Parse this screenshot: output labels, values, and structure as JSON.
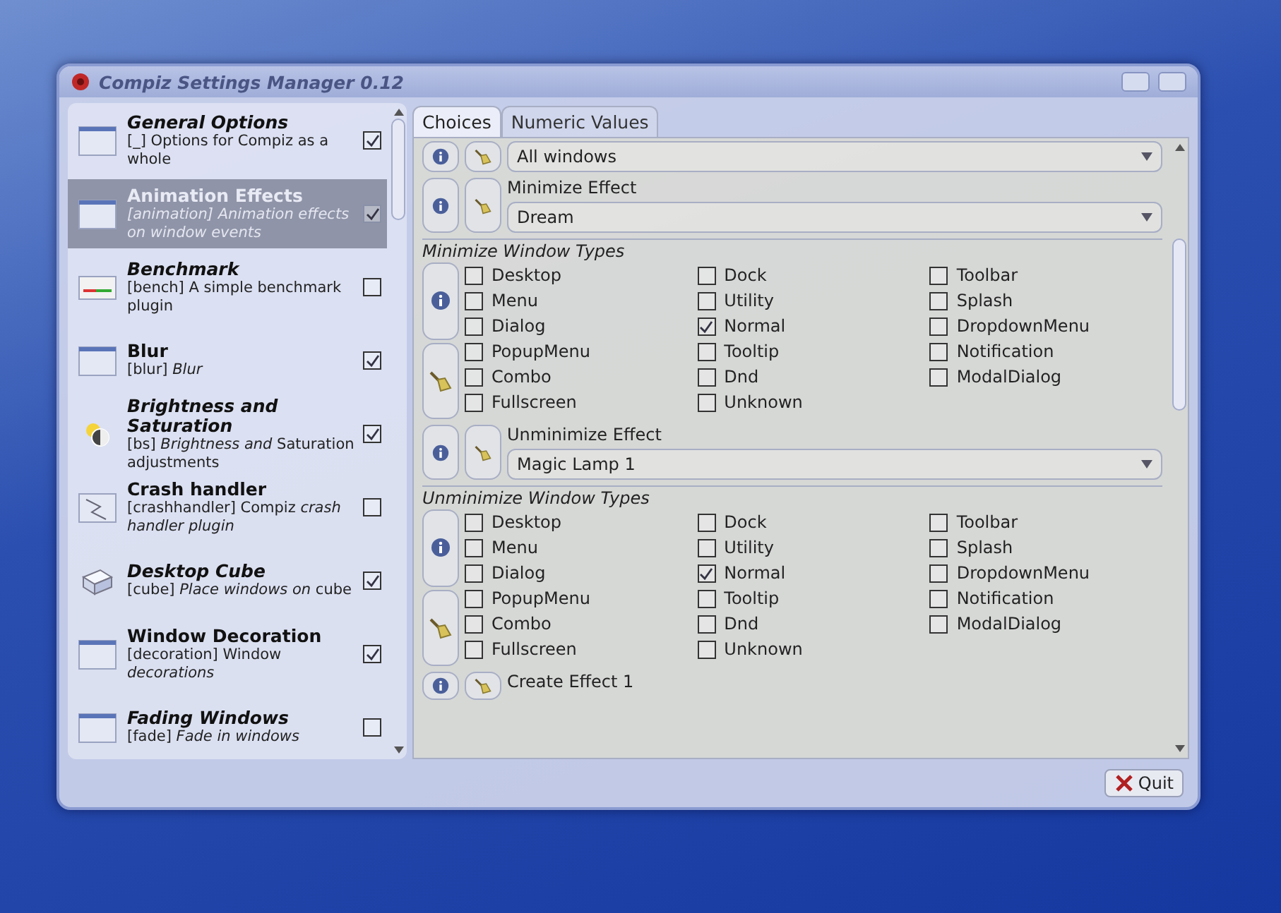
{
  "window": {
    "title": "Compiz Settings Manager 0.12"
  },
  "plugins": [
    {
      "name": "General Options",
      "italic": true,
      "description": "[_] Options for Compiz as a whole",
      "enabled": true,
      "selected": false,
      "kind": "window"
    },
    {
      "name": "Animation Effects",
      "italic": false,
      "description": "[animation] Animation effects on window events",
      "enabled": true,
      "selected": true,
      "kind": "window"
    },
    {
      "name": "Benchmark",
      "italic": true,
      "description": "[bench] A simple benchmark plugin",
      "enabled": false,
      "selected": false,
      "kind": "meter"
    },
    {
      "name": "Blur",
      "italic": false,
      "description": "[blur] *Blur*",
      "enabled": true,
      "selected": false,
      "kind": "window"
    },
    {
      "name": "Brightness and Saturation",
      "italic": true,
      "description": "[bs] *Brightness and* Saturation adjustments",
      "enabled": true,
      "selected": false,
      "kind": "sun"
    },
    {
      "name": "Crash handler",
      "italic": false,
      "description": "[crashhandler] Compiz *crash handler plugin*",
      "enabled": false,
      "selected": false,
      "kind": "crash"
    },
    {
      "name": "Desktop Cube",
      "italic": true,
      "description": "[cube] *Place windows on* cube",
      "enabled": true,
      "selected": false,
      "kind": "cube"
    },
    {
      "name": "Window Decoration",
      "italic": false,
      "description": "[decoration] Window *decorations*",
      "enabled": true,
      "selected": false,
      "kind": "window"
    },
    {
      "name": "Fading Windows",
      "italic": true,
      "description": "[fade] *Fade in windows*",
      "enabled": false,
      "selected": false,
      "kind": "window"
    }
  ],
  "tabs": [
    {
      "label": "Choices",
      "selected": true
    },
    {
      "label": "Numeric Values",
      "selected": false
    }
  ],
  "settings": [
    {
      "kind": "combo",
      "value": "All windows"
    },
    {
      "kind": "combo",
      "label": "Minimize Effect",
      "value": "Dream"
    },
    {
      "kind": "types",
      "title": "Minimize Window Types",
      "options": [
        {
          "label": "Desktop",
          "checked": false
        },
        {
          "label": "Dock",
          "checked": false
        },
        {
          "label": "Toolbar",
          "checked": false
        },
        {
          "label": "Menu",
          "checked": false
        },
        {
          "label": "Utility",
          "checked": false
        },
        {
          "label": "Splash",
          "checked": false
        },
        {
          "label": "Dialog",
          "checked": false
        },
        {
          "label": "Normal",
          "checked": true
        },
        {
          "label": "DropdownMenu",
          "checked": false
        },
        {
          "label": "PopupMenu",
          "checked": false
        },
        {
          "label": "Tooltip",
          "checked": false
        },
        {
          "label": "Notification",
          "checked": false
        },
        {
          "label": "Combo",
          "checked": false
        },
        {
          "label": "Dnd",
          "checked": false
        },
        {
          "label": "ModalDialog",
          "checked": false
        },
        {
          "label": "Fullscreen",
          "checked": false
        },
        {
          "label": "Unknown",
          "checked": false
        }
      ]
    },
    {
      "kind": "combo",
      "label": "Unminimize Effect",
      "value": "Magic Lamp 1"
    },
    {
      "kind": "types",
      "title": "Unminimize Window Types",
      "options": [
        {
          "label": "Desktop",
          "checked": false
        },
        {
          "label": "Dock",
          "checked": false
        },
        {
          "label": "Toolbar",
          "checked": false
        },
        {
          "label": "Menu",
          "checked": false
        },
        {
          "label": "Utility",
          "checked": false
        },
        {
          "label": "Splash",
          "checked": false
        },
        {
          "label": "Dialog",
          "checked": false
        },
        {
          "label": "Normal",
          "checked": true
        },
        {
          "label": "DropdownMenu",
          "checked": false
        },
        {
          "label": "PopupMenu",
          "checked": false
        },
        {
          "label": "Tooltip",
          "checked": false
        },
        {
          "label": "Notification",
          "checked": false
        },
        {
          "label": "Combo",
          "checked": false
        },
        {
          "label": "Dnd",
          "checked": false
        },
        {
          "label": "ModalDialog",
          "checked": false
        },
        {
          "label": "Fullscreen",
          "checked": false
        },
        {
          "label": "Unknown",
          "checked": false
        }
      ]
    },
    {
      "kind": "label",
      "label": "Create Effect 1"
    }
  ],
  "quit_button": "Quit"
}
